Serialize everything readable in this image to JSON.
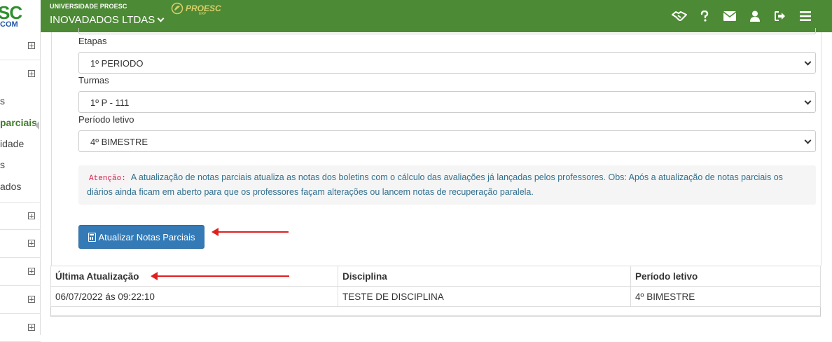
{
  "header": {
    "logo_text": "SC",
    "logo_suffix": "COM",
    "university": "UNIVERSIDADE PROESC",
    "company": "INOVADADOS LTDAS",
    "brand": "PROESC",
    "brand_sub": "ERP"
  },
  "header_icons": [
    "handshake-icon",
    "help-icon",
    "envelope-icon",
    "user-icon",
    "sign-out-icon",
    "menu-icon"
  ],
  "sidebar": {
    "items": [
      {
        "label": "s"
      },
      {
        "label": "parciais",
        "active": true
      },
      {
        "label": "idade"
      },
      {
        "label": "s"
      },
      {
        "label": "ados"
      }
    ]
  },
  "form": {
    "etapas_label": "Etapas",
    "etapas_value": "1º PERIODO",
    "turmas_label": "Turmas",
    "turmas_value": "1º P - 111",
    "periodo_label": "Período letivo",
    "periodo_value": "4º BIMESTRE"
  },
  "alert": {
    "tag": "Atenção:",
    "text": "A atualização de notas parciais atualiza as notas dos boletins com o cálculo das avaliações já lançadas pelos professores. Obs: Após a atualização de notas parciais os diários ainda ficam em aberto para que os professores façam alterações ou lancem notas de recuperação paralela."
  },
  "button": {
    "label": "Atualizar Notas Parciais"
  },
  "table": {
    "headers": [
      "Última Atualização",
      "Disciplina",
      "Período letivo"
    ],
    "rows": [
      [
        "06/07/2022 ás 09:22:10",
        "TESTE DE DISCIPLINA",
        "4º BIMESTRE"
      ]
    ]
  },
  "colors": {
    "header_bg": "#4d8a35",
    "primary_button": "#337ab7",
    "annotation_arrow": "#e02020",
    "active_sidebar": "#3f7d2a"
  }
}
